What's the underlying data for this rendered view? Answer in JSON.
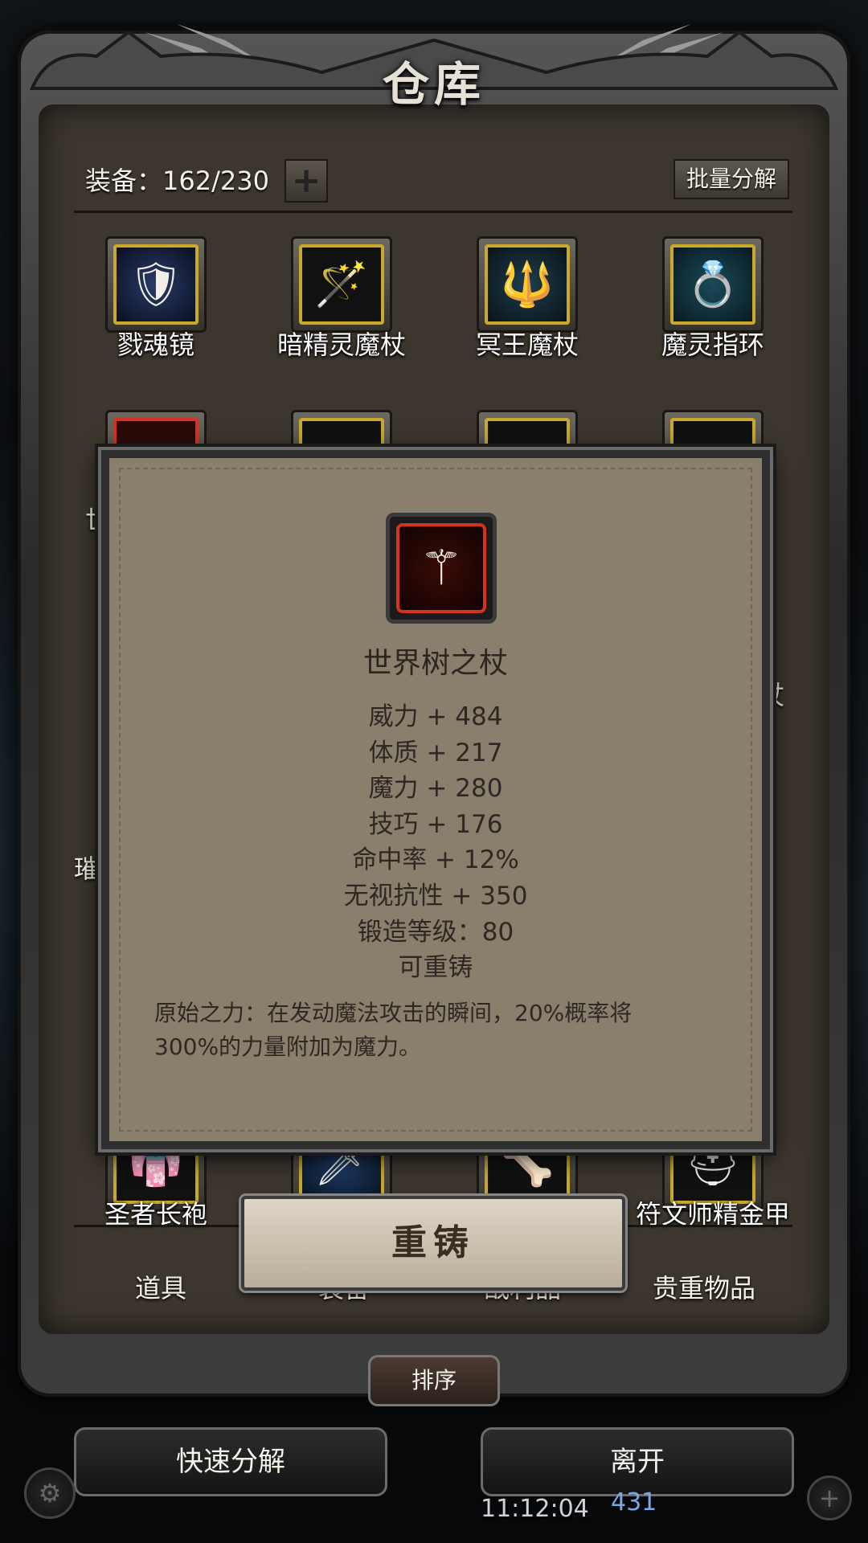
{
  "window": {
    "title": "仓库"
  },
  "header": {
    "capacity_text": "装备：162/230",
    "add_symbol": "+",
    "bulk_label": "批量分解"
  },
  "grid_row1": [
    {
      "name": "戮魂镜",
      "icon": "mirror-icon",
      "glyph": "🛡"
    },
    {
      "name": "暗精灵魔杖",
      "icon": "staff-icon",
      "glyph": "🪄"
    },
    {
      "name": "冥王魔杖",
      "icon": "scepter-icon",
      "glyph": "🔱"
    },
    {
      "name": "魔灵指环",
      "icon": "ring-icon",
      "glyph": "💍"
    }
  ],
  "grid_bottom_row": [
    {
      "name": "圣者长袍",
      "icon": "robe-icon",
      "glyph": "👘"
    },
    {
      "name": "",
      "icon": "blade-icon",
      "glyph": "🗡"
    },
    {
      "name": "",
      "icon": "claw-icon",
      "glyph": "🦴"
    },
    {
      "name": "符文师精金甲",
      "icon": "helmet-icon",
      "glyph": "⛑"
    }
  ],
  "partial_labels": {
    "left1": "世",
    "right2": "杖",
    "left3": "璀"
  },
  "tabs": [
    "道具",
    "装备",
    "战利品",
    "贵重物品"
  ],
  "sort_label": "排序",
  "buttons": {
    "quick_dismantle": "快速分解",
    "leave": "离开",
    "reforge": "重铸"
  },
  "hud": {
    "time": "11:12:04",
    "gems": "431"
  },
  "popup": {
    "icon": "world-tree-staff-icon",
    "glyph": "⚚",
    "item_name": "世界树之杖",
    "stats": [
      "威力 + 484",
      "体质 + 217",
      "魔力 + 280",
      "技巧 + 176",
      "命中率 + 12%",
      "无视抗性 + 350",
      "锻造等级：80",
      "可重铸"
    ],
    "passive_line1": "原始之力：在发动魔法攻击的瞬间，20%概率将",
    "passive_line2": "300%的力量附加为魔力。"
  },
  "colors": {
    "rarity_gold": "#c9a82a",
    "rarity_red": "#d8321f",
    "popup_bg": "#8a7f6d"
  }
}
